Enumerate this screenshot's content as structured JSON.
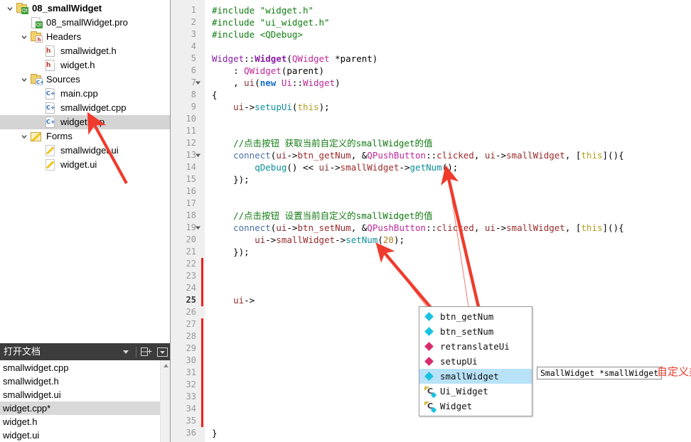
{
  "sidebar": {
    "tree": [
      {
        "indent": 0,
        "twisty": "expanded",
        "icon": "qt-project-folder-icon",
        "label": "08_smallWidget",
        "bold": true,
        "selected": false
      },
      {
        "indent": 1,
        "twisty": "none",
        "icon": "qt-pro-file-icon",
        "label": "08_smallWidget.pro",
        "bold": false,
        "selected": false
      },
      {
        "indent": 1,
        "twisty": "expanded",
        "icon": "headers-folder-icon",
        "label": "Headers",
        "bold": false,
        "selected": false
      },
      {
        "indent": 2,
        "twisty": "none",
        "icon": "header-file-icon",
        "label": "smallwidget.h",
        "bold": false,
        "selected": false
      },
      {
        "indent": 2,
        "twisty": "none",
        "icon": "header-file-icon",
        "label": "widget.h",
        "bold": false,
        "selected": false
      },
      {
        "indent": 1,
        "twisty": "expanded",
        "icon": "sources-folder-icon",
        "label": "Sources",
        "bold": false,
        "selected": false
      },
      {
        "indent": 2,
        "twisty": "none",
        "icon": "cpp-file-icon",
        "label": "main.cpp",
        "bold": false,
        "selected": false
      },
      {
        "indent": 2,
        "twisty": "none",
        "icon": "cpp-file-icon",
        "label": "smallwidget.cpp",
        "bold": false,
        "selected": false
      },
      {
        "indent": 2,
        "twisty": "none",
        "icon": "cpp-file-icon",
        "label": "widget.cpp",
        "bold": false,
        "selected": true
      },
      {
        "indent": 1,
        "twisty": "expanded",
        "icon": "forms-folder-icon",
        "label": "Forms",
        "bold": false,
        "selected": false
      },
      {
        "indent": 2,
        "twisty": "none",
        "icon": "ui-file-icon",
        "label": "smallwidget.ui",
        "bold": false,
        "selected": false
      },
      {
        "indent": 2,
        "twisty": "none",
        "icon": "ui-file-icon",
        "label": "widget.ui",
        "bold": false,
        "selected": false
      }
    ],
    "opendocs": {
      "title": "打开文档",
      "dropdown_icon": "chevron-down-icon",
      "split_icon": "split-add-icon",
      "close_icon": "close-panel-icon",
      "items": [
        {
          "label": "smallwidget.cpp",
          "selected": false
        },
        {
          "label": "smallwidget.h",
          "selected": false
        },
        {
          "label": "smallwidget.ui",
          "selected": false
        },
        {
          "label": "widget.cpp*",
          "selected": true
        },
        {
          "label": "widget.h",
          "selected": false
        },
        {
          "label": "widget.ui",
          "selected": false
        }
      ]
    }
  },
  "editor": {
    "lines": [
      {
        "n": 1,
        "fold": false,
        "change": false,
        "current": false
      },
      {
        "n": 2,
        "fold": false,
        "change": false,
        "current": false
      },
      {
        "n": 3,
        "fold": false,
        "change": false,
        "current": false
      },
      {
        "n": 4,
        "fold": false,
        "change": false,
        "current": false
      },
      {
        "n": 5,
        "fold": false,
        "change": false,
        "current": false
      },
      {
        "n": 6,
        "fold": false,
        "change": false,
        "current": false
      },
      {
        "n": 7,
        "fold": true,
        "change": false,
        "current": false
      },
      {
        "n": 8,
        "fold": false,
        "change": false,
        "current": false
      },
      {
        "n": 9,
        "fold": false,
        "change": false,
        "current": false
      },
      {
        "n": 10,
        "fold": false,
        "change": false,
        "current": false
      },
      {
        "n": 11,
        "fold": false,
        "change": false,
        "current": false
      },
      {
        "n": 12,
        "fold": false,
        "change": false,
        "current": false
      },
      {
        "n": 13,
        "fold": true,
        "change": false,
        "current": false
      },
      {
        "n": 14,
        "fold": false,
        "change": false,
        "current": false
      },
      {
        "n": 15,
        "fold": false,
        "change": false,
        "current": false
      },
      {
        "n": 16,
        "fold": false,
        "change": false,
        "current": false
      },
      {
        "n": 17,
        "fold": false,
        "change": false,
        "current": false
      },
      {
        "n": 18,
        "fold": false,
        "change": false,
        "current": false
      },
      {
        "n": 19,
        "fold": true,
        "change": false,
        "current": false
      },
      {
        "n": 20,
        "fold": false,
        "change": false,
        "current": false
      },
      {
        "n": 21,
        "fold": false,
        "change": false,
        "current": false
      },
      {
        "n": 22,
        "fold": false,
        "change": true,
        "current": false
      },
      {
        "n": 23,
        "fold": false,
        "change": true,
        "current": false
      },
      {
        "n": 24,
        "fold": false,
        "change": true,
        "current": false
      },
      {
        "n": 25,
        "fold": false,
        "change": true,
        "current": true
      },
      {
        "n": 26,
        "fold": false,
        "change": false,
        "current": false
      },
      {
        "n": 27,
        "fold": false,
        "change": true,
        "current": false
      },
      {
        "n": 28,
        "fold": false,
        "change": true,
        "current": false
      },
      {
        "n": 29,
        "fold": false,
        "change": true,
        "current": false
      },
      {
        "n": 30,
        "fold": false,
        "change": true,
        "current": false
      },
      {
        "n": 31,
        "fold": false,
        "change": true,
        "current": false
      },
      {
        "n": 32,
        "fold": false,
        "change": true,
        "current": false
      },
      {
        "n": 33,
        "fold": false,
        "change": true,
        "current": false
      },
      {
        "n": 34,
        "fold": false,
        "change": true,
        "current": false
      },
      {
        "n": 35,
        "fold": false,
        "change": true,
        "current": false
      },
      {
        "n": 36,
        "fold": false,
        "change": false,
        "current": false
      }
    ],
    "code": [
      {
        "n": 1,
        "tokens": [
          {
            "t": "#include ",
            "c": "t-pre"
          },
          {
            "t": "\"widget.h\"",
            "c": "t-str"
          }
        ]
      },
      {
        "n": 2,
        "tokens": [
          {
            "t": "#include ",
            "c": "t-pre"
          },
          {
            "t": "\"ui_widget.h\"",
            "c": "t-str"
          }
        ]
      },
      {
        "n": 3,
        "tokens": [
          {
            "t": "#include ",
            "c": "t-pre"
          },
          {
            "t": "<QDebug>",
            "c": "t-str"
          }
        ]
      },
      {
        "n": 4,
        "tokens": []
      },
      {
        "n": 5,
        "tokens": [
          {
            "t": "Widget",
            "c": "t-cls"
          },
          {
            "t": "::",
            "c": "t-punc"
          },
          {
            "t": "Widget",
            "c": "t-cls bold"
          },
          {
            "t": "(",
            "c": "t-punc"
          },
          {
            "t": "QWidget",
            "c": "t-qcls"
          },
          {
            "t": " *parent)",
            "c": "t-punc"
          }
        ]
      },
      {
        "n": 6,
        "tokens": [
          {
            "t": "    : ",
            "c": "t-punc"
          },
          {
            "t": "QWidget",
            "c": "t-qcls"
          },
          {
            "t": "(parent)",
            "c": "t-punc"
          }
        ]
      },
      {
        "n": 7,
        "tokens": [
          {
            "t": "    , ",
            "c": "t-punc"
          },
          {
            "t": "ui",
            "c": "t-var"
          },
          {
            "t": "(",
            "c": "t-punc"
          },
          {
            "t": "new",
            "c": "t-kw"
          },
          {
            "t": " ",
            "c": "t-punc"
          },
          {
            "t": "Ui",
            "c": "t-qcls"
          },
          {
            "t": "::",
            "c": "t-punc"
          },
          {
            "t": "Widget",
            "c": "t-qcls"
          },
          {
            "t": ")",
            "c": "t-punc"
          }
        ]
      },
      {
        "n": 8,
        "tokens": [
          {
            "t": "{",
            "c": "t-punc"
          }
        ]
      },
      {
        "n": 9,
        "tokens": [
          {
            "t": "    ",
            "c": "t-punc"
          },
          {
            "t": "ui",
            "c": "t-var"
          },
          {
            "t": "->",
            "c": "t-punc"
          },
          {
            "t": "setupUi",
            "c": "t-fn"
          },
          {
            "t": "(",
            "c": "t-punc"
          },
          {
            "t": "this",
            "c": "t-this"
          },
          {
            "t": ");",
            "c": "t-punc"
          }
        ]
      },
      {
        "n": 10,
        "tokens": []
      },
      {
        "n": 11,
        "tokens": []
      },
      {
        "n": 12,
        "tokens": [
          {
            "t": "    //点击按钮 获取当前自定义的smallWidget的值",
            "c": "t-cmt"
          }
        ]
      },
      {
        "n": 13,
        "tokens": [
          {
            "t": "    ",
            "c": "t-punc"
          },
          {
            "t": "connect",
            "c": "t-conn"
          },
          {
            "t": "(",
            "c": "t-punc"
          },
          {
            "t": "ui",
            "c": "t-var"
          },
          {
            "t": "->",
            "c": "t-punc"
          },
          {
            "t": "btn_getNum",
            "c": "t-mem"
          },
          {
            "t": ", &",
            "c": "t-punc"
          },
          {
            "t": "QPushButton",
            "c": "t-qcls"
          },
          {
            "t": "::",
            "c": "t-punc"
          },
          {
            "t": "clicked",
            "c": "t-mem"
          },
          {
            "t": ", ",
            "c": "t-punc"
          },
          {
            "t": "ui",
            "c": "t-var"
          },
          {
            "t": "->",
            "c": "t-punc"
          },
          {
            "t": "smallWidget",
            "c": "t-mem"
          },
          {
            "t": ", [",
            "c": "t-punc"
          },
          {
            "t": "this",
            "c": "t-this"
          },
          {
            "t": "](){",
            "c": "t-punc"
          }
        ]
      },
      {
        "n": 14,
        "tokens": [
          {
            "t": "        ",
            "c": "t-punc"
          },
          {
            "t": "qDebug",
            "c": "t-fn"
          },
          {
            "t": "() << ",
            "c": "t-punc"
          },
          {
            "t": "ui",
            "c": "t-var"
          },
          {
            "t": "->",
            "c": "t-punc"
          },
          {
            "t": "smallWidget",
            "c": "t-mem"
          },
          {
            "t": "->",
            "c": "t-punc"
          },
          {
            "t": "getNum",
            "c": "t-fn"
          },
          {
            "t": "();",
            "c": "t-punc"
          }
        ]
      },
      {
        "n": 15,
        "tokens": [
          {
            "t": "    });",
            "c": "t-punc"
          }
        ]
      },
      {
        "n": 16,
        "tokens": []
      },
      {
        "n": 17,
        "tokens": []
      },
      {
        "n": 18,
        "tokens": [
          {
            "t": "    //点击按钮 设置当前自定义的smallWidget的值",
            "c": "t-cmt"
          }
        ]
      },
      {
        "n": 19,
        "tokens": [
          {
            "t": "    ",
            "c": "t-punc"
          },
          {
            "t": "connect",
            "c": "t-conn"
          },
          {
            "t": "(",
            "c": "t-punc"
          },
          {
            "t": "ui",
            "c": "t-var"
          },
          {
            "t": "->",
            "c": "t-punc"
          },
          {
            "t": "btn_setNum",
            "c": "t-mem"
          },
          {
            "t": ", &",
            "c": "t-punc"
          },
          {
            "t": "QPushButton",
            "c": "t-qcls"
          },
          {
            "t": "::",
            "c": "t-punc"
          },
          {
            "t": "clicked",
            "c": "t-mem"
          },
          {
            "t": ", ",
            "c": "t-punc"
          },
          {
            "t": "ui",
            "c": "t-var"
          },
          {
            "t": "->",
            "c": "t-punc"
          },
          {
            "t": "smallWidget",
            "c": "t-mem"
          },
          {
            "t": ", [",
            "c": "t-punc"
          },
          {
            "t": "this",
            "c": "t-this"
          },
          {
            "t": "](){",
            "c": "t-punc"
          }
        ]
      },
      {
        "n": 20,
        "tokens": [
          {
            "t": "        ",
            "c": "t-punc"
          },
          {
            "t": "ui",
            "c": "t-var"
          },
          {
            "t": "->",
            "c": "t-punc"
          },
          {
            "t": "smallWidget",
            "c": "t-mem"
          },
          {
            "t": "->",
            "c": "t-punc"
          },
          {
            "t": "setNum",
            "c": "t-fn"
          },
          {
            "t": "(",
            "c": "t-punc"
          },
          {
            "t": "20",
            "c": "t-num"
          },
          {
            "t": ");",
            "c": "t-punc"
          }
        ]
      },
      {
        "n": 21,
        "tokens": [
          {
            "t": "    });",
            "c": "t-punc"
          }
        ]
      },
      {
        "n": 25,
        "tokens": [
          {
            "t": "    ",
            "c": "t-punc"
          },
          {
            "t": "ui",
            "c": "t-var"
          },
          {
            "t": "->",
            "c": "t-punc"
          }
        ]
      },
      {
        "n": 36,
        "tokens": [
          {
            "t": "}",
            "c": "t-punc"
          }
        ]
      }
    ]
  },
  "autocomplete": {
    "items": [
      {
        "label": "btn_getNum",
        "icon": "variable-diamond-icon",
        "kind": "cyan",
        "selected": false
      },
      {
        "label": "btn_setNum",
        "icon": "variable-diamond-icon",
        "kind": "cyan",
        "selected": false
      },
      {
        "label": "retranslateUi",
        "icon": "method-diamond-icon",
        "kind": "pink",
        "selected": false
      },
      {
        "label": "setupUi",
        "icon": "method-diamond-icon",
        "kind": "pink",
        "selected": false
      },
      {
        "label": "smallWidget",
        "icon": "variable-diamond-icon",
        "kind": "cyan",
        "selected": true
      },
      {
        "label": "Ui_Widget",
        "icon": "class-icon",
        "kind": "class",
        "selected": false
      },
      {
        "label": "Widget",
        "icon": "class-icon",
        "kind": "class",
        "selected": false
      }
    ]
  },
  "tooltip": {
    "text": "SmallWidget *smallWidget"
  },
  "annotation": {
    "text": "自定义类 SmallWidget 的接口",
    "color": "#ee3a2e"
  }
}
